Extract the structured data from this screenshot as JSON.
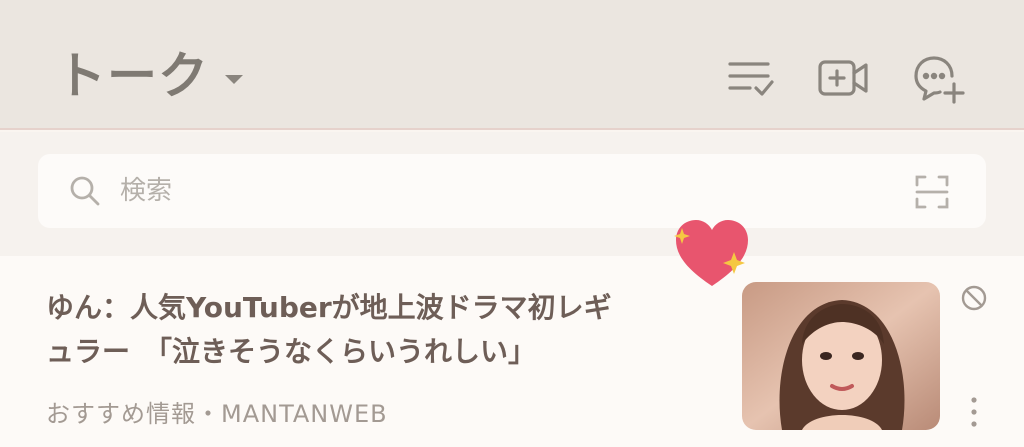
{
  "header": {
    "title": "トーク",
    "icons": [
      "sort-check-icon",
      "add-video-icon",
      "new-chat-icon"
    ]
  },
  "search": {
    "placeholder": "検索"
  },
  "news": {
    "headline_line1": "ゆん：人気YouTuberが地上波ドラマ初レギ",
    "headline_line2": "ュラー　「泣きそうなくらいうれしい」",
    "source": "おすすめ情報・MANTANWEB"
  },
  "colors": {
    "header_bg": "#ebe6e0",
    "title": "#7f7a73",
    "icon": "#8a857e",
    "heart": "#e8556e",
    "sparkle": "#f5c842"
  }
}
